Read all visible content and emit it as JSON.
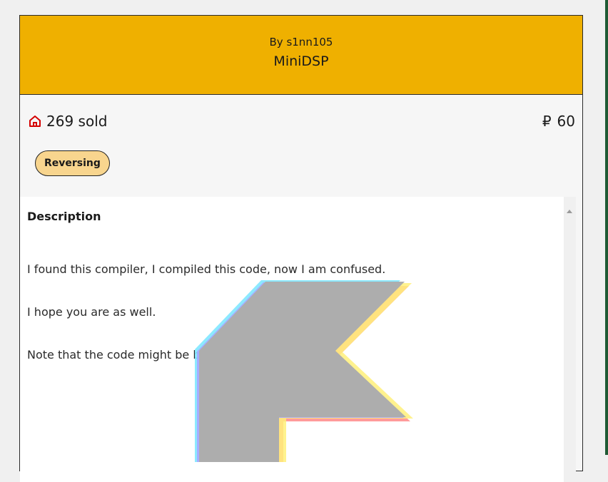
{
  "challenge": {
    "author_line": "By s1nn105",
    "title": "MiniDSP",
    "sold_text": "269 sold",
    "currency_symbol": "₽",
    "price": "60",
    "tag": "Reversing"
  },
  "description": {
    "heading": "Description",
    "lines": [
      "I found this compiler, I compiled this code, now I am confused.",
      "I hope you are as well.",
      "Note that the code might be broken."
    ]
  },
  "colors": {
    "header": "#efb000",
    "tag": "#f8d58e",
    "sold_icon": "#d40000",
    "right_stripe": "#1f5a34"
  },
  "icons": {
    "sold": "home-icon",
    "scroll_up": "triangle-up-icon",
    "pointer": "large-arrow-cursor-icon"
  }
}
